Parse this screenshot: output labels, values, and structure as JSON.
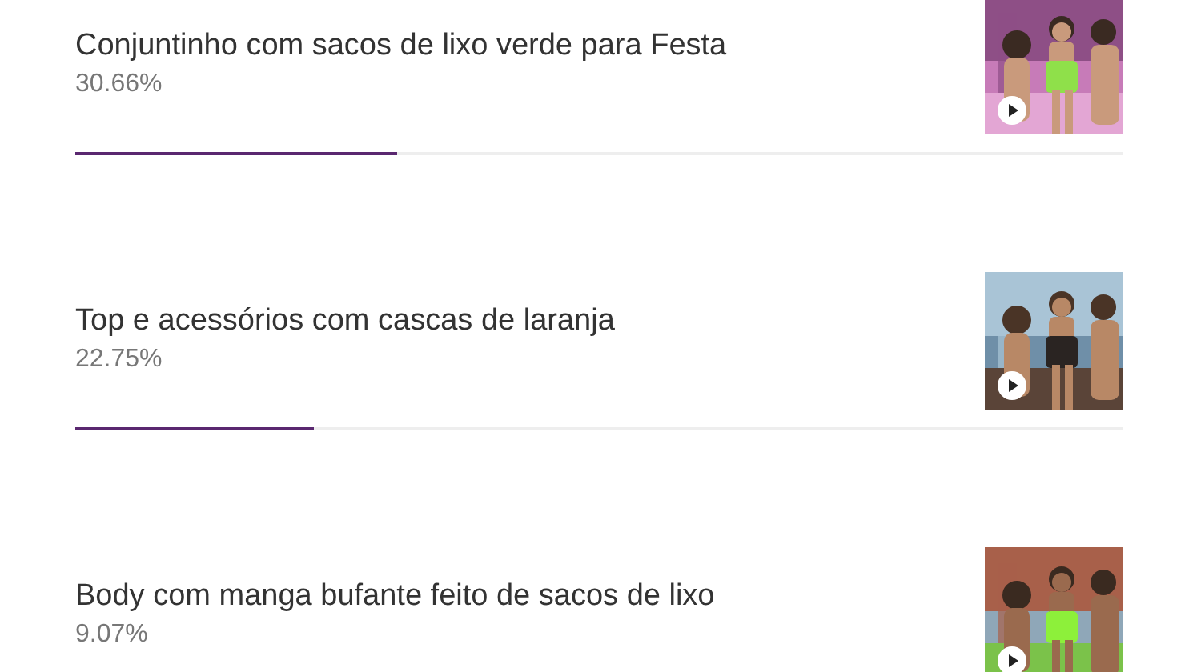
{
  "options": [
    {
      "title": "Conjuntinho com sacos de lixo verde para Festa",
      "percent": "30.66%",
      "level": 0.3066
    },
    {
      "title": "Top e acessórios com cascas de laranja",
      "percent": "22.75%",
      "level": 0.2275
    },
    {
      "title": "Body com manga bufante feito de sacos de lixo",
      "percent": "9.07%"
    }
  ]
}
